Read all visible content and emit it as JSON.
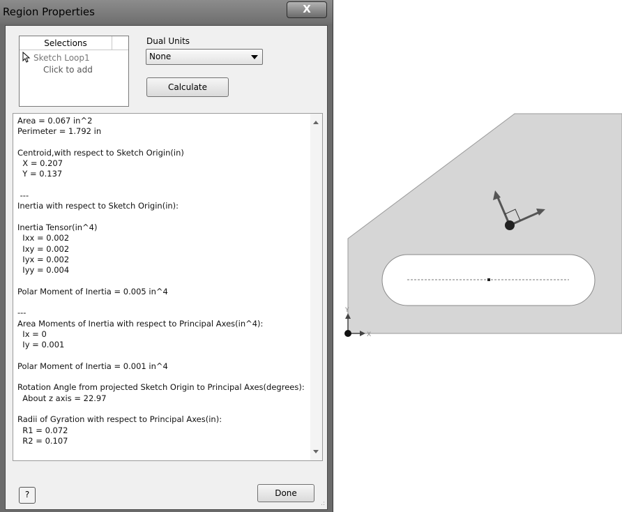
{
  "dialog": {
    "title": "Region Properties",
    "close_label": "X",
    "selections": {
      "header": "Selections",
      "items": [
        "Sketch Loop1"
      ],
      "add_prompt": "Click to add"
    },
    "dual_units": {
      "label": "Dual Units",
      "selected": "None"
    },
    "calculate_label": "Calculate",
    "results": [
      "Area = 0.067 in^2",
      "Perimeter = 1.792 in",
      "",
      "Centroid,with respect to Sketch Origin(in)",
      "  X = 0.207",
      "  Y = 0.137",
      "",
      " ---",
      "Inertia with respect to Sketch Origin(in):",
      "",
      "Inertia Tensor(in^4)",
      "  Ixx = 0.002",
      "  Ixy = 0.002",
      "  Iyx = 0.002",
      "  Iyy = 0.004",
      "",
      "Polar Moment of Inertia = 0.005 in^4",
      "",
      "---",
      "Area Moments of Inertia with respect to Principal Axes(in^4):",
      "  Ix = 0",
      "  Iy = 0.001",
      "",
      "Polar Moment of Inertia = 0.001 in^4",
      "",
      "Rotation Angle from projected Sketch Origin to Principal Axes(degrees):",
      "  About z axis = 22.97",
      "",
      "Radii of Gyration with respect to Principal Axes(in):",
      "  R1 = 0.072",
      "  R2 = 0.107"
    ],
    "help_label": "?",
    "done_label": "Done"
  },
  "sketch": {
    "origin_x_label": "X",
    "origin_y_label": "Y"
  },
  "icons": [
    "close-icon",
    "cursor-icon",
    "dropdown-arrow-icon",
    "scroll-up-icon",
    "scroll-down-icon",
    "help-icon",
    "resize-grip-icon",
    "principal-axes-icon",
    "origin-triad-icon"
  ],
  "colors": {
    "titlebar": "#7d7d7d",
    "dialog_bg": "#f0f0f0",
    "sketch_fill": "#d4d4d4",
    "axis_arrow": "#555555"
  }
}
